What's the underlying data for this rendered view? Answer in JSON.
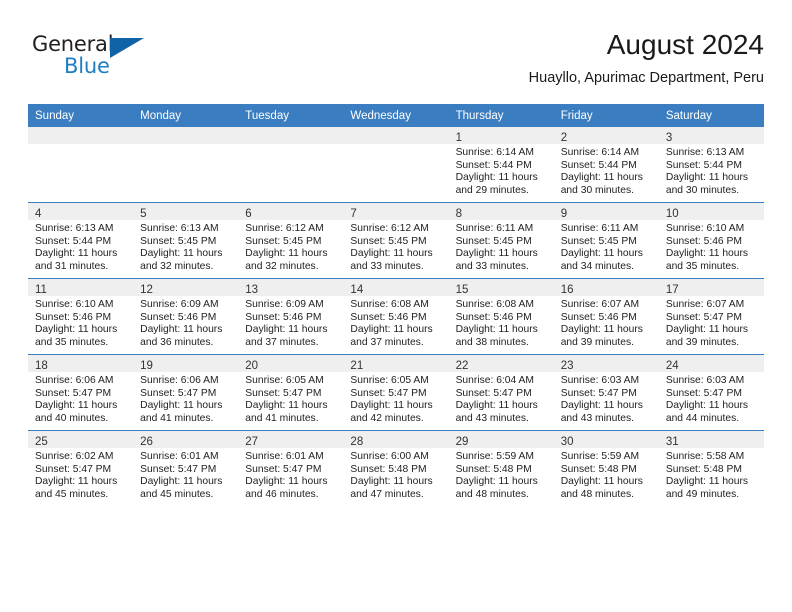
{
  "brand": {
    "name_top": "General",
    "name_bottom": "Blue",
    "accent_color": "#1163a8",
    "text_color": "#231f20"
  },
  "header": {
    "title": "August 2024",
    "subtitle": "Huayllo, Apurimac Department, Peru"
  },
  "theme": {
    "header_blue": "#3a7dc0",
    "daynum_band": "#efefef",
    "cell_bg": "#ffffff"
  },
  "weekday_headers": [
    "Sunday",
    "Monday",
    "Tuesday",
    "Wednesday",
    "Thursday",
    "Friday",
    "Saturday"
  ],
  "weeks": [
    [
      {
        "day": "",
        "sunrise": "",
        "sunset": "",
        "daylight_1": "",
        "daylight_2": ""
      },
      {
        "day": "",
        "sunrise": "",
        "sunset": "",
        "daylight_1": "",
        "daylight_2": ""
      },
      {
        "day": "",
        "sunrise": "",
        "sunset": "",
        "daylight_1": "",
        "daylight_2": ""
      },
      {
        "day": "",
        "sunrise": "",
        "sunset": "",
        "daylight_1": "",
        "daylight_2": ""
      },
      {
        "day": "1",
        "sunrise": "Sunrise: 6:14 AM",
        "sunset": "Sunset: 5:44 PM",
        "daylight_1": "Daylight: 11 hours",
        "daylight_2": "and 29 minutes."
      },
      {
        "day": "2",
        "sunrise": "Sunrise: 6:14 AM",
        "sunset": "Sunset: 5:44 PM",
        "daylight_1": "Daylight: 11 hours",
        "daylight_2": "and 30 minutes."
      },
      {
        "day": "3",
        "sunrise": "Sunrise: 6:13 AM",
        "sunset": "Sunset: 5:44 PM",
        "daylight_1": "Daylight: 11 hours",
        "daylight_2": "and 30 minutes."
      }
    ],
    [
      {
        "day": "4",
        "sunrise": "Sunrise: 6:13 AM",
        "sunset": "Sunset: 5:44 PM",
        "daylight_1": "Daylight: 11 hours",
        "daylight_2": "and 31 minutes."
      },
      {
        "day": "5",
        "sunrise": "Sunrise: 6:13 AM",
        "sunset": "Sunset: 5:45 PM",
        "daylight_1": "Daylight: 11 hours",
        "daylight_2": "and 32 minutes."
      },
      {
        "day": "6",
        "sunrise": "Sunrise: 6:12 AM",
        "sunset": "Sunset: 5:45 PM",
        "daylight_1": "Daylight: 11 hours",
        "daylight_2": "and 32 minutes."
      },
      {
        "day": "7",
        "sunrise": "Sunrise: 6:12 AM",
        "sunset": "Sunset: 5:45 PM",
        "daylight_1": "Daylight: 11 hours",
        "daylight_2": "and 33 minutes."
      },
      {
        "day": "8",
        "sunrise": "Sunrise: 6:11 AM",
        "sunset": "Sunset: 5:45 PM",
        "daylight_1": "Daylight: 11 hours",
        "daylight_2": "and 33 minutes."
      },
      {
        "day": "9",
        "sunrise": "Sunrise: 6:11 AM",
        "sunset": "Sunset: 5:45 PM",
        "daylight_1": "Daylight: 11 hours",
        "daylight_2": "and 34 minutes."
      },
      {
        "day": "10",
        "sunrise": "Sunrise: 6:10 AM",
        "sunset": "Sunset: 5:46 PM",
        "daylight_1": "Daylight: 11 hours",
        "daylight_2": "and 35 minutes."
      }
    ],
    [
      {
        "day": "11",
        "sunrise": "Sunrise: 6:10 AM",
        "sunset": "Sunset: 5:46 PM",
        "daylight_1": "Daylight: 11 hours",
        "daylight_2": "and 35 minutes."
      },
      {
        "day": "12",
        "sunrise": "Sunrise: 6:09 AM",
        "sunset": "Sunset: 5:46 PM",
        "daylight_1": "Daylight: 11 hours",
        "daylight_2": "and 36 minutes."
      },
      {
        "day": "13",
        "sunrise": "Sunrise: 6:09 AM",
        "sunset": "Sunset: 5:46 PM",
        "daylight_1": "Daylight: 11 hours",
        "daylight_2": "and 37 minutes."
      },
      {
        "day": "14",
        "sunrise": "Sunrise: 6:08 AM",
        "sunset": "Sunset: 5:46 PM",
        "daylight_1": "Daylight: 11 hours",
        "daylight_2": "and 37 minutes."
      },
      {
        "day": "15",
        "sunrise": "Sunrise: 6:08 AM",
        "sunset": "Sunset: 5:46 PM",
        "daylight_1": "Daylight: 11 hours",
        "daylight_2": "and 38 minutes."
      },
      {
        "day": "16",
        "sunrise": "Sunrise: 6:07 AM",
        "sunset": "Sunset: 5:46 PM",
        "daylight_1": "Daylight: 11 hours",
        "daylight_2": "and 39 minutes."
      },
      {
        "day": "17",
        "sunrise": "Sunrise: 6:07 AM",
        "sunset": "Sunset: 5:47 PM",
        "daylight_1": "Daylight: 11 hours",
        "daylight_2": "and 39 minutes."
      }
    ],
    [
      {
        "day": "18",
        "sunrise": "Sunrise: 6:06 AM",
        "sunset": "Sunset: 5:47 PM",
        "daylight_1": "Daylight: 11 hours",
        "daylight_2": "and 40 minutes."
      },
      {
        "day": "19",
        "sunrise": "Sunrise: 6:06 AM",
        "sunset": "Sunset: 5:47 PM",
        "daylight_1": "Daylight: 11 hours",
        "daylight_2": "and 41 minutes."
      },
      {
        "day": "20",
        "sunrise": "Sunrise: 6:05 AM",
        "sunset": "Sunset: 5:47 PM",
        "daylight_1": "Daylight: 11 hours",
        "daylight_2": "and 41 minutes."
      },
      {
        "day": "21",
        "sunrise": "Sunrise: 6:05 AM",
        "sunset": "Sunset: 5:47 PM",
        "daylight_1": "Daylight: 11 hours",
        "daylight_2": "and 42 minutes."
      },
      {
        "day": "22",
        "sunrise": "Sunrise: 6:04 AM",
        "sunset": "Sunset: 5:47 PM",
        "daylight_1": "Daylight: 11 hours",
        "daylight_2": "and 43 minutes."
      },
      {
        "day": "23",
        "sunrise": "Sunrise: 6:03 AM",
        "sunset": "Sunset: 5:47 PM",
        "daylight_1": "Daylight: 11 hours",
        "daylight_2": "and 43 minutes."
      },
      {
        "day": "24",
        "sunrise": "Sunrise: 6:03 AM",
        "sunset": "Sunset: 5:47 PM",
        "daylight_1": "Daylight: 11 hours",
        "daylight_2": "and 44 minutes."
      }
    ],
    [
      {
        "day": "25",
        "sunrise": "Sunrise: 6:02 AM",
        "sunset": "Sunset: 5:47 PM",
        "daylight_1": "Daylight: 11 hours",
        "daylight_2": "and 45 minutes."
      },
      {
        "day": "26",
        "sunrise": "Sunrise: 6:01 AM",
        "sunset": "Sunset: 5:47 PM",
        "daylight_1": "Daylight: 11 hours",
        "daylight_2": "and 45 minutes."
      },
      {
        "day": "27",
        "sunrise": "Sunrise: 6:01 AM",
        "sunset": "Sunset: 5:47 PM",
        "daylight_1": "Daylight: 11 hours",
        "daylight_2": "and 46 minutes."
      },
      {
        "day": "28",
        "sunrise": "Sunrise: 6:00 AM",
        "sunset": "Sunset: 5:48 PM",
        "daylight_1": "Daylight: 11 hours",
        "daylight_2": "and 47 minutes."
      },
      {
        "day": "29",
        "sunrise": "Sunrise: 5:59 AM",
        "sunset": "Sunset: 5:48 PM",
        "daylight_1": "Daylight: 11 hours",
        "daylight_2": "and 48 minutes."
      },
      {
        "day": "30",
        "sunrise": "Sunrise: 5:59 AM",
        "sunset": "Sunset: 5:48 PM",
        "daylight_1": "Daylight: 11 hours",
        "daylight_2": "and 48 minutes."
      },
      {
        "day": "31",
        "sunrise": "Sunrise: 5:58 AM",
        "sunset": "Sunset: 5:48 PM",
        "daylight_1": "Daylight: 11 hours",
        "daylight_2": "and 49 minutes."
      }
    ]
  ]
}
